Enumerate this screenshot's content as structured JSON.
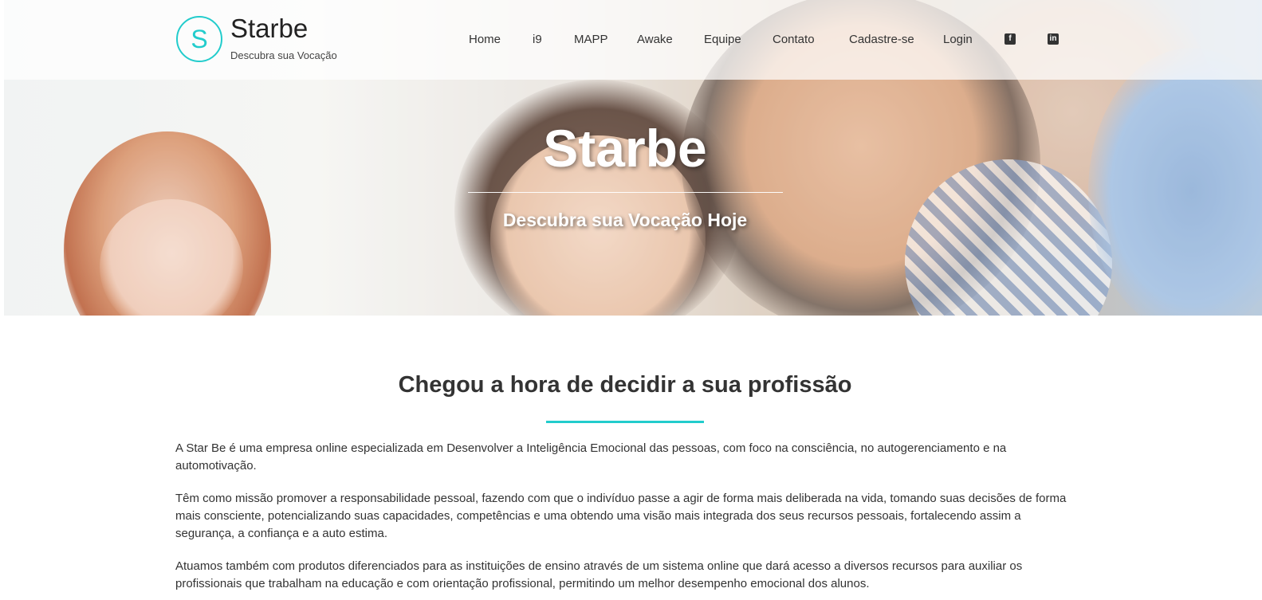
{
  "colors": {
    "accent": "#22cccc",
    "text": "#333333",
    "white": "#ffffff"
  },
  "brand": {
    "logo_letter": "S",
    "name": "Starbe",
    "tagline": "Descubra sua Vocação"
  },
  "nav": {
    "items": [
      {
        "label": "Home"
      },
      {
        "label": "i9"
      },
      {
        "label": "MAPP"
      },
      {
        "label": "Awake"
      },
      {
        "label": "Equipe"
      },
      {
        "label": "Contato"
      },
      {
        "label": "Cadastre-se"
      },
      {
        "label": "Login"
      }
    ],
    "social": [
      {
        "icon": "facebook-icon",
        "glyph": "f"
      },
      {
        "icon": "linkedin-icon",
        "glyph": "in"
      }
    ]
  },
  "hero": {
    "title": "Starbe",
    "subtitle": "Descubra sua Vocação Hoje"
  },
  "content": {
    "heading": "Chegou a hora de decidir a sua profissão",
    "paragraphs": [
      "A Star Be é uma empresa online especializada em Desenvolver a Inteligência Emocional das pessoas, com foco na consciência, no autogerenciamento e na automotivação.",
      "Têm como missão promover a responsabilidade pessoal, fazendo com que o indivíduo passe a agir de forma mais deliberada na vida, tomando suas decisões de forma mais consciente, potencializando suas capacidades, competências e uma obtendo uma visão mais integrada dos seus recursos pessoais, fortalecendo assim a segurança, a confiança e a auto estima.",
      "Atuamos também com produtos diferenciados para as instituições de ensino através de um sistema online que dará acesso a diversos recursos para auxiliar os profissionais que trabalham na educação e com orientação profissional, permitindo um melhor desempenho emocional dos alunos."
    ]
  }
}
